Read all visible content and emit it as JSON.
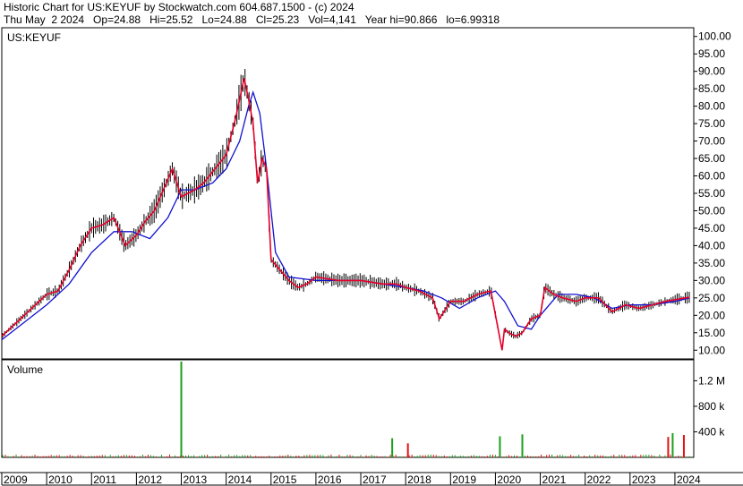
{
  "header": {
    "line1": "Historic Chart for US:KEYUF by Stockwatch.com 604.687.1500 - (c) 2024",
    "line2": "Thu May  2 2024   Op=24.88   Hi=25.52   Lo=24.88   Cl=25.23   Vol=4,141   Year hi=90.866   lo=6.99318"
  },
  "colors": {
    "price_line": "#e8002a",
    "price_bars": "#000000",
    "moving_average": "#1010d0",
    "volume_up": "#1aa01a",
    "volume_down": "#e81010",
    "grid": "#000000"
  },
  "chart_data": {
    "type": "line",
    "title": "US:KEYUF",
    "price_axis": {
      "ylim": [
        7.5,
        102.5
      ],
      "ticks": [
        "100.00",
        "95.00",
        "90.00",
        "85.00",
        "80.00",
        "75.00",
        "70.00",
        "65.00",
        "60.00",
        "55.00",
        "50.00",
        "45.00",
        "40.00",
        "35.00",
        "30.00",
        "25.00",
        "20.00",
        "15.00",
        "10.00"
      ]
    },
    "x_years": [
      "2009",
      "2010",
      "2011",
      "2012",
      "2013",
      "2014",
      "2015",
      "2016",
      "2017",
      "2018",
      "2019",
      "2020",
      "2021",
      "2022",
      "2023",
      "2024"
    ],
    "price_series": {
      "name": "Close",
      "x": [
        2009.0,
        2009.25,
        2009.5,
        2009.75,
        2010.0,
        2010.25,
        2010.5,
        2010.75,
        2011.0,
        2011.25,
        2011.5,
        2011.75,
        2012.0,
        2012.2,
        2012.4,
        2012.6,
        2012.8,
        2013.0,
        2013.15,
        2013.3,
        2013.5,
        2013.75,
        2014.0,
        2014.2,
        2014.4,
        2014.5,
        2014.6,
        2014.7,
        2014.8,
        2014.9,
        2015.0,
        2015.2,
        2015.4,
        2015.6,
        2015.8,
        2016.0,
        2016.5,
        2017.0,
        2017.5,
        2017.8,
        2018.0,
        2018.3,
        2018.6,
        2018.75,
        2019.0,
        2019.3,
        2019.6,
        2019.9,
        2020.15,
        2020.2,
        2020.3,
        2020.45,
        2020.6,
        2020.8,
        2021.0,
        2021.1,
        2021.3,
        2021.5,
        2021.8,
        2022.0,
        2022.3,
        2022.6,
        2022.9,
        2023.2,
        2023.5,
        2023.8,
        2024.0,
        2024.33
      ],
      "values": [
        14,
        17,
        20,
        23,
        26,
        27,
        33,
        40,
        45,
        46,
        48,
        40,
        43,
        47,
        50,
        56,
        62,
        54,
        55,
        56,
        58,
        62,
        66,
        76,
        88,
        82,
        75,
        58,
        65,
        62,
        36,
        33,
        30,
        28,
        29,
        31,
        30,
        30,
        29,
        29,
        28,
        27,
        25,
        19,
        24,
        24,
        26,
        27,
        10,
        16,
        15,
        14,
        15,
        19,
        20,
        28,
        26,
        25,
        24,
        25,
        25,
        21,
        23,
        22,
        23,
        24,
        24.5,
        25.2
      ]
    },
    "ma_series": {
      "name": "Moving Average",
      "x": [
        2009.0,
        2009.5,
        2010.0,
        2010.5,
        2011.0,
        2011.5,
        2011.9,
        2012.3,
        2012.7,
        2013.0,
        2013.3,
        2013.7,
        2014.0,
        2014.3,
        2014.5,
        2014.6,
        2014.75,
        2014.9,
        2015.1,
        2015.4,
        2016.0,
        2016.5,
        2017.0,
        2017.5,
        2018.0,
        2018.4,
        2018.8,
        2019.2,
        2019.6,
        2020.0,
        2020.2,
        2020.5,
        2020.8,
        2021.0,
        2021.4,
        2021.8,
        2022.2,
        2022.6,
        2023.0,
        2023.5,
        2024.0,
        2024.33
      ],
      "values": [
        13,
        18,
        23,
        29,
        38,
        44,
        44,
        42,
        48,
        56,
        56,
        58,
        62,
        70,
        80,
        84,
        78,
        62,
        38,
        31,
        30,
        30,
        30,
        29,
        28,
        27,
        25,
        22,
        25,
        27,
        24,
        17,
        16,
        20,
        26,
        26,
        25,
        22,
        23,
        23,
        24,
        25
      ]
    },
    "volume_axis": {
      "ylim": [
        0,
        1500
      ],
      "ticks": [
        "1.2 M",
        "800 k",
        "400 k"
      ]
    },
    "volume_label": "Volume",
    "volume_spikes": [
      {
        "x": 2013.0,
        "value": 1500,
        "color": "green"
      },
      {
        "x": 2017.7,
        "value": 300,
        "color": "green"
      },
      {
        "x": 2018.05,
        "value": 220,
        "color": "red"
      },
      {
        "x": 2020.1,
        "value": 330,
        "color": "green"
      },
      {
        "x": 2020.6,
        "value": 360,
        "color": "green"
      },
      {
        "x": 2023.85,
        "value": 320,
        "color": "red"
      },
      {
        "x": 2023.95,
        "value": 380,
        "color": "green"
      },
      {
        "x": 2024.2,
        "value": 350,
        "color": "red"
      }
    ]
  }
}
